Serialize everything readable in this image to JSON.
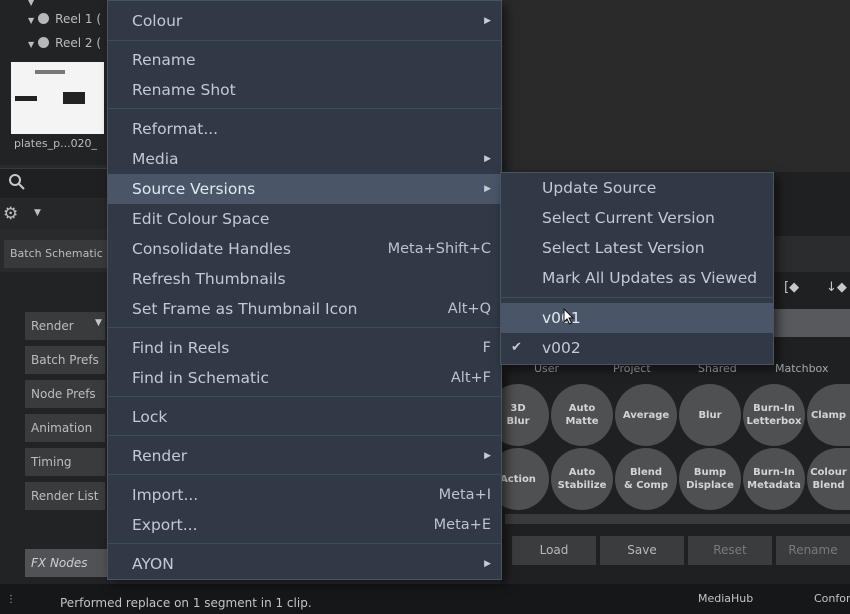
{
  "background": {
    "tree": {
      "reels": [
        {
          "label": "Reel 1 ("
        },
        {
          "label": "Reel 2 ("
        }
      ]
    },
    "thumbnail_label": "plates_p...020_",
    "batch_tab": "Batch Schematic",
    "left_buttons": [
      "Render",
      "Batch Prefs",
      "Node Prefs",
      "Animation",
      "Timing",
      "Render List"
    ],
    "fx_nodes": "FX Nodes",
    "library_tabs": [
      "User",
      "Project",
      "Shared",
      "Matchbox"
    ],
    "nodes_row1": [
      "3D\nBlur",
      "Auto\nMatte",
      "Average",
      "Blur",
      "Burn-In\nLetterbox",
      "Clamp"
    ],
    "nodes_row2": [
      "Action",
      "Auto\nStabilize",
      "Blend\n& Comp",
      "Bump\nDisplace",
      "Burn-In\nMetadata",
      "Colour\nBlend"
    ],
    "footer_buttons": [
      "Load",
      "Save",
      "Reset",
      "Rename"
    ]
  },
  "status": {
    "message": "Performed replace on 1 segment in 1 clip.",
    "mediahub": "MediaHub",
    "conform": "Confor"
  },
  "menu": {
    "items": [
      {
        "label": "Colour",
        "submenu": true
      },
      {
        "label": "Rename"
      },
      {
        "label": "Rename Shot"
      },
      {
        "label": "Reformat..."
      },
      {
        "label": "Media",
        "submenu": true
      },
      {
        "label": "Source Versions",
        "submenu": true,
        "highlighted": true
      },
      {
        "label": "Edit Colour Space"
      },
      {
        "label": "Consolidate Handles",
        "shortcut": "Meta+Shift+C"
      },
      {
        "label": "Refresh Thumbnails"
      },
      {
        "label": "Set Frame as Thumbnail Icon",
        "shortcut": "Alt+Q"
      },
      {
        "label": "Find in Reels",
        "shortcut": "F"
      },
      {
        "label": "Find in Schematic",
        "shortcut": "Alt+F"
      },
      {
        "label": "Lock"
      },
      {
        "label": "Render",
        "submenu": true
      },
      {
        "label": "Import...",
        "shortcut": "Meta+I"
      },
      {
        "label": "Export...",
        "shortcut": "Meta+E"
      },
      {
        "label": "AYON",
        "submenu": true
      }
    ]
  },
  "submenu": {
    "items": [
      {
        "label": "Update Source"
      },
      {
        "label": "Select Current Version"
      },
      {
        "label": "Select Latest Version"
      },
      {
        "label": "Mark All Updates as Viewed"
      },
      {
        "label": "v001",
        "highlighted": true
      },
      {
        "label": "v002",
        "checked": true
      }
    ]
  }
}
